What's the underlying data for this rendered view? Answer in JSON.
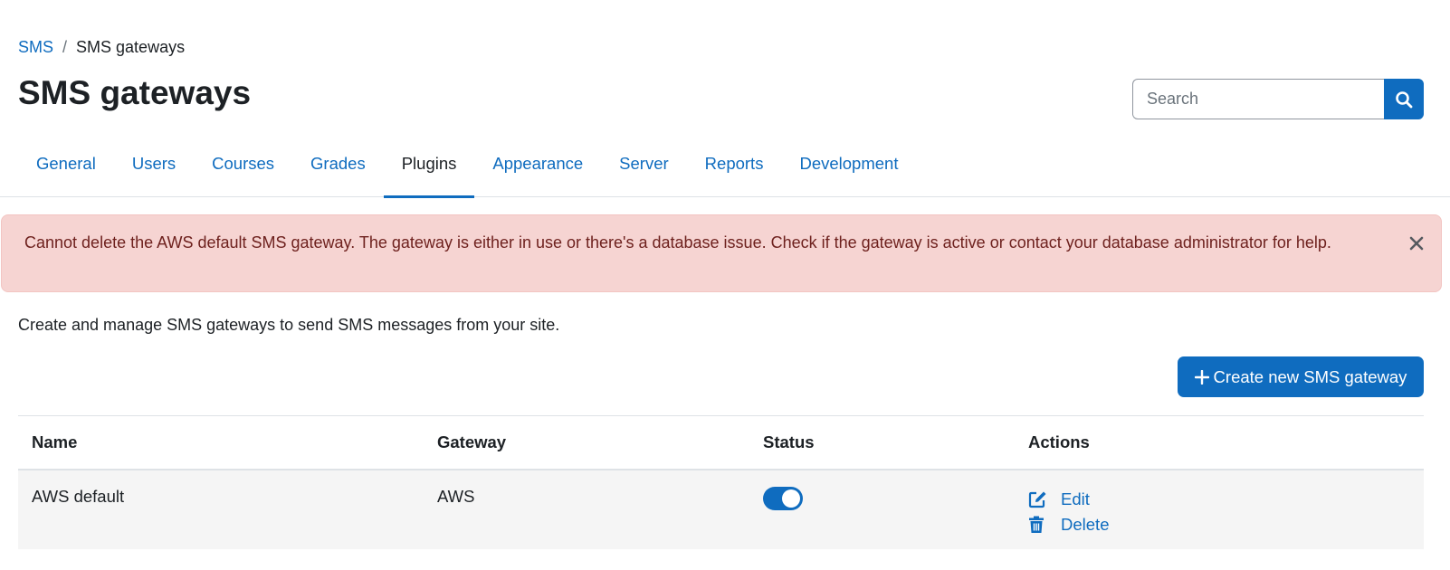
{
  "breadcrumb": {
    "items": [
      {
        "label": "SMS"
      },
      {
        "label": "SMS gateways"
      }
    ],
    "separator": "/"
  },
  "page_title": "SMS gateways",
  "search": {
    "placeholder": "Search",
    "value": "",
    "icon": "search-icon"
  },
  "tabs": [
    {
      "label": "General",
      "active": false
    },
    {
      "label": "Users",
      "active": false
    },
    {
      "label": "Courses",
      "active": false
    },
    {
      "label": "Grades",
      "active": false
    },
    {
      "label": "Plugins",
      "active": true
    },
    {
      "label": "Appearance",
      "active": false
    },
    {
      "label": "Server",
      "active": false
    },
    {
      "label": "Reports",
      "active": false
    },
    {
      "label": "Development",
      "active": false
    }
  ],
  "alert": {
    "message": "Cannot delete the AWS default SMS gateway. The gateway is either in use or there's a database issue. Check if the gateway is active or contact your database administrator for help.",
    "close_icon": "close-icon",
    "type": "error"
  },
  "description": "Create and manage SMS gateways to send SMS messages from your site.",
  "create_button": {
    "label": "Create new SMS gateway",
    "icon": "plus-icon"
  },
  "table": {
    "columns": [
      "Name",
      "Gateway",
      "Status",
      "Actions"
    ],
    "rows": [
      {
        "name": "AWS default",
        "gateway": "AWS",
        "status_enabled": true,
        "actions": [
          {
            "label": "Edit",
            "icon": "edit-icon"
          },
          {
            "label": "Delete",
            "icon": "trash-icon"
          }
        ]
      }
    ]
  },
  "colors": {
    "primary": "#0f6cbf",
    "text": "#1d2125",
    "alert_bg": "#f6d4d2",
    "alert_text": "#6e211e",
    "row_bg": "#f5f5f5"
  }
}
